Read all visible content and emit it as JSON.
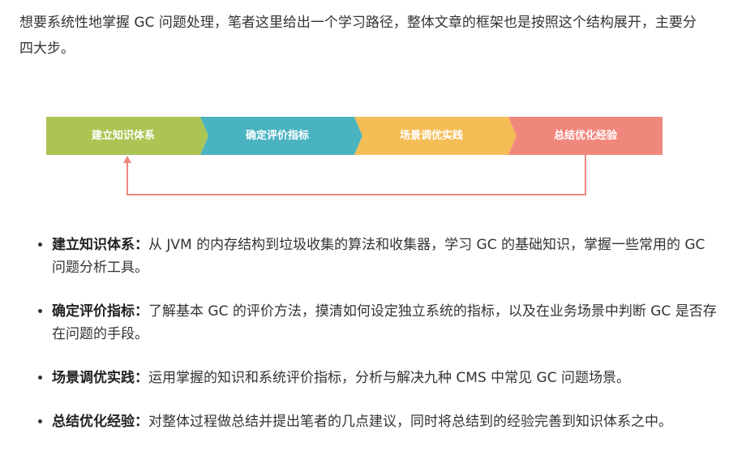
{
  "intro": "想要系统性地掌握 GC 问题处理，笔者这里给出一个学习路径，整体文章的框架也是按照这个结构展开，主要分四大步。",
  "flow": {
    "steps": [
      {
        "label": "建立知识体系",
        "color": "#acc453"
      },
      {
        "label": "确定评价指标",
        "color": "#4ab3c0"
      },
      {
        "label": "场景调优实践",
        "color": "#f5bd55"
      },
      {
        "label": "总结优化经验",
        "color": "#f0877d"
      }
    ],
    "loop_color": "#f0877d"
  },
  "points": [
    {
      "title": "建立知识体系：",
      "text": "从 JVM 的内存结构到垃圾收集的算法和收集器，学习 GC 的基础知识，掌握一些常用的 GC 问题分析工具。"
    },
    {
      "title": "确定评价指标：",
      "text": "了解基本 GC 的评价方法，摸清如何设定独立系统的指标，以及在业务场景中判断 GC 是否存在问题的手段。"
    },
    {
      "title": "场景调优实践：",
      "text": "运用掌握的知识和系统评价指标，分析与解决九种 CMS 中常见 GC 问题场景。"
    },
    {
      "title": "总结优化经验：",
      "text": "对整体过程做总结并提出笔者的几点建议，同时将总结到的经验完善到知识体系之中。"
    }
  ]
}
